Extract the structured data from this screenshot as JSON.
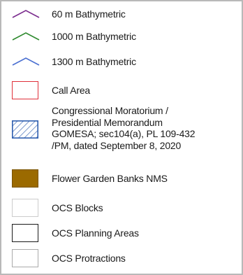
{
  "legend": {
    "items": [
      {
        "label": "60 m Bathymetric",
        "symbol": "line-icon",
        "color": "#7b2c8e"
      },
      {
        "label": "1000 m Bathymetric",
        "symbol": "line-icon",
        "color": "#2f8a2f"
      },
      {
        "label": "1300 m Bathymetric",
        "symbol": "line-icon",
        "color": "#4a6fd1"
      },
      {
        "label": "Call Area",
        "symbol": "outline-box",
        "color": "#e0303a"
      },
      {
        "label_lines": [
          "Congressional Moratorium /",
          "Presidential Memorandum",
          "GOMESA; sec104(a), PL 109-432",
          "/PM, dated September 8, 2020"
        ],
        "symbol": "hatched-box",
        "color": "#2f5fb0"
      },
      {
        "label": "Flower Garden Banks NMS",
        "symbol": "filled-box",
        "color": "#9b6a00"
      },
      {
        "label": "OCS Blocks",
        "symbol": "outline-box",
        "color": "#cccccc"
      },
      {
        "label": "OCS Planning Areas",
        "symbol": "outline-box",
        "color": "#1a1a1a"
      },
      {
        "label": "OCS Protractions",
        "symbol": "outline-box",
        "color": "#aaaaaa"
      }
    ]
  }
}
